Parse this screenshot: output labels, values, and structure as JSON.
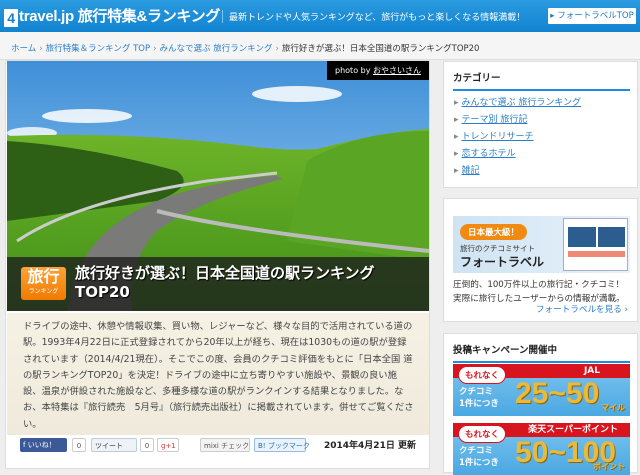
{
  "header": {
    "logo_num": "4",
    "logo": "travel.jp",
    "section": "旅行特集&ランキング",
    "tagline": "最新トレンドや人気ランキングなど、旅行がもっと楽しくなる情報満載！",
    "fortravel_btn": "▸ フォートラベルTOP"
  },
  "breadcrumb": [
    "ホーム",
    "旅行特集＆ランキング TOP",
    "みんなで選ぶ 旅行ランキング",
    "旅行好きが選ぶ！日本全国道の駅ランキングTOP20"
  ],
  "hero": {
    "credit_prefix": "photo by",
    "credit_name": "おやさいさん",
    "badge_main": "旅行",
    "badge_sub": "ランキング",
    "title_line1": "旅行好きが選ぶ！日本全国道の駅ランキング",
    "title_line2": "TOP20"
  },
  "description": "ドライブの途中、休憩や情報収集、買い物、レジャーなど、様々な目的で活用されている道の駅。1993年4月22日に正式登録されてから20年以上が経ち、現在は1030もの道の駅が登録されています（2014/4/21現在）。そこでこの度、会員のクチコミ評価をもとに「日本全国 道の駅ランキングTOP20」を決定！ドライブの途中に立ち寄りやすい施設や、景観の良い施設、温泉が併設された施設など、多種多様な道の駅がランクインする結果となりました。なお、本特集は『旅行読売　5月号』（旅行読売出版社）に掲載されています。併せてご覧ください。",
  "social": {
    "like": "f いいね！",
    "like_count": "0",
    "tweet": "ツイート",
    "tweet_count": "0",
    "gplus": "g+1",
    "mixi": "mixi チェック",
    "hatena": "B! ブックマーク",
    "updated": "2014年4月21日 更新"
  },
  "sidebar": {
    "category_title": "カテゴリー",
    "categories": [
      "みんなで選ぶ 旅行ランキング",
      "テーマ別 旅行記",
      "トレンドリサーチ",
      "恋するホテル",
      "雑記"
    ],
    "ad": {
      "pill": "日本最大級！",
      "sub": "旅行のクチコミサイト",
      "name": "フォートラベル",
      "text1": "圧倒的、100万件以上の旅行記・クチコミ！",
      "text2": "実際に旅行したユーザーからの情報が満載。",
      "link": "フォートラベルを見る ›"
    },
    "campaign_title": "投稿キャンペーン開催中",
    "campaigns": [
      {
        "pill": "もれなく",
        "brand": "JAL",
        "left": "クチコミ\n1件につき",
        "amount": "25~50",
        "unit": "マイル"
      },
      {
        "pill": "もれなく",
        "brand": "楽天スーパーポイント",
        "left": "クチコミ\n1件につき",
        "amount": "50~100",
        "unit": "ポイント"
      }
    ]
  }
}
